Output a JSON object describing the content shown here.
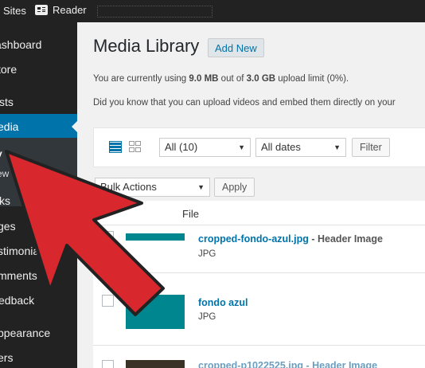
{
  "adminbar": {
    "sites_label": "Sites",
    "reader_label": "Reader",
    "reader_icon": "reader-icon"
  },
  "sidebar": {
    "items": [
      {
        "label": "ashboard"
      },
      {
        "label": "tore"
      },
      {
        "label": "sts"
      },
      {
        "label": "edia"
      },
      {
        "label": "ks"
      },
      {
        "label": "ges"
      },
      {
        "label": "stimonial"
      },
      {
        "label": "mments"
      },
      {
        "label": "edback"
      },
      {
        "label": "ppearance"
      },
      {
        "label": "ers"
      }
    ],
    "submenu": [
      {
        "label": "y"
      },
      {
        "label": "ew"
      }
    ]
  },
  "main": {
    "title": "Media Library",
    "add_new_label": "Add New",
    "notice_prefix": "You are currently using ",
    "notice_used": "9.0 MB",
    "notice_mid": " out of ",
    "notice_limit": "3.0 GB",
    "notice_suffix": " upload limit (0%).",
    "notice2": "Did you know that you can upload videos and embed them directly on your"
  },
  "toolbar": {
    "list_view_icon": "list-view-icon",
    "grid_view_icon": "grid-view-icon",
    "type_filter": "All (10)",
    "date_filter": "All dates",
    "filter_label": "Filter",
    "bulk_actions": "Bulk Actions",
    "apply_label": "Apply"
  },
  "table": {
    "column_file": "File",
    "rows": [
      {
        "name": "cropped-fondo-azul.jpg",
        "suffix": " - Header Image",
        "type": "JPG"
      },
      {
        "name": "fondo azul",
        "suffix": "",
        "type": "JPG"
      },
      {
        "name": "cropped-p1022525.jpg - Header Image",
        "suffix": "",
        "type": ""
      }
    ]
  },
  "colors": {
    "accent": "#0073aa",
    "thumb": "#00868f",
    "arrow": "#d9272e",
    "sidebar": "#222222"
  }
}
